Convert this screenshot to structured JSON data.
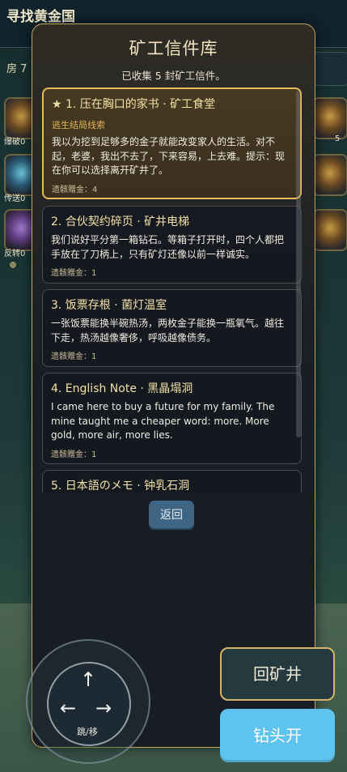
{
  "background": {
    "game_title": "寻找黄金国",
    "room_label": "房 7",
    "skills": [
      {
        "label": "爆破0"
      },
      {
        "label": "传送0"
      },
      {
        "label": "反转0"
      }
    ],
    "right_card_count": "5"
  },
  "modal": {
    "title": "矿工信件库",
    "subtitle": "已收集 5 封矿工信件。",
    "letters": [
      {
        "title": "★ 1. 压在胸口的家书 · 矿工食堂",
        "tag": "逃生结局线索",
        "text": "我以为挖到足够多的金子就能改变家人的生活。对不起，老婆，我出不去了，下来容易，上去难。提示：现在你可以选择离开矿井了。",
        "count": "遗骸赠金：4"
      },
      {
        "title": "2. 合伙契约碎页 · 矿井电梯",
        "text": "我们说好平分第一箱钻石。等箱子打开时，四个人都把手放在了刀柄上，只有矿灯还像以前一样诚实。",
        "count": "遗骸赠金：1"
      },
      {
        "title": "3. 饭票存根 · 菌灯温室",
        "text": "一张饭票能换半碗热汤，两枚金子能换一瓶氧气。越往下走，热汤越像奢侈，呼吸越像债务。",
        "count": "遗骸赠金：1"
      },
      {
        "title": "4. English Note · 黑晶塌洞",
        "text": "I came here to buy a future for my family. The mine taught me a cheaper word: more. More gold, more air, more lies.",
        "count": "遗骸赠金：1"
      },
      {
        "title": "5. 日本語のメモ · 钟乳石洞"
      }
    ],
    "back_label": "返回"
  },
  "controls": {
    "joystick_label": "跳/移",
    "up_arrow": "↑",
    "left_arrow": "←",
    "right_arrow": "→",
    "return_mine_label": "回矿井",
    "drill_label": "钻头开"
  }
}
